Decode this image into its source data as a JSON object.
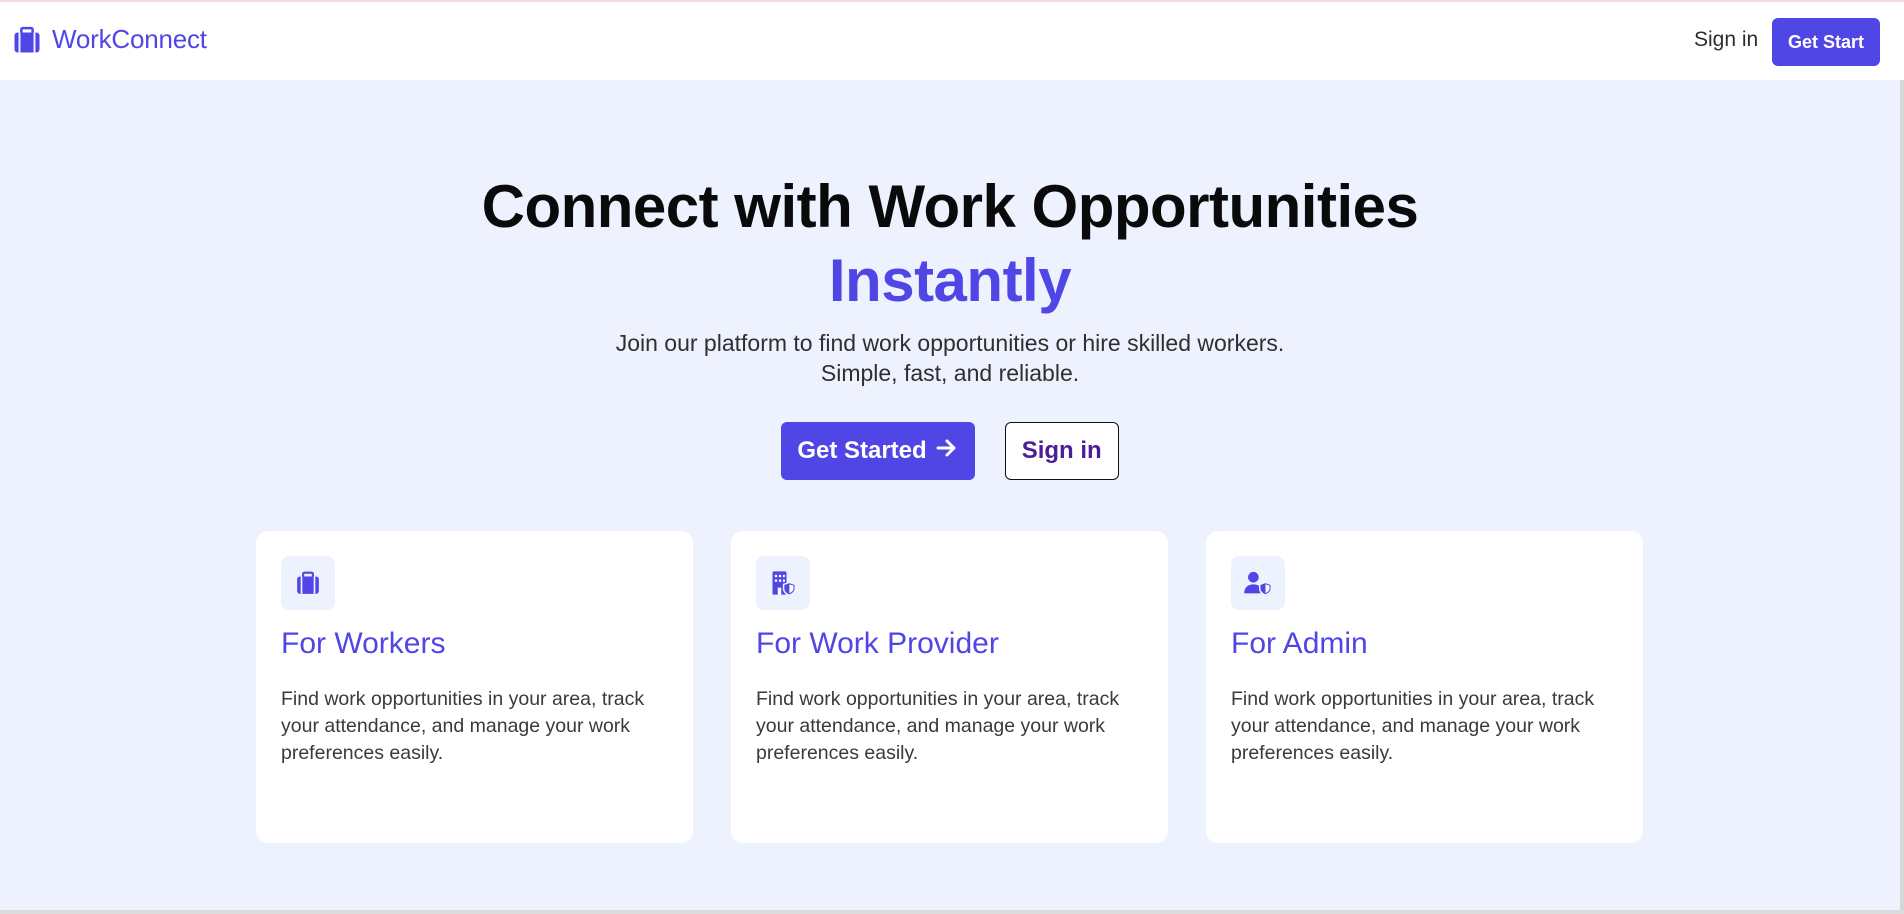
{
  "brand": {
    "name": "WorkConnect",
    "icon": "briefcase-icon"
  },
  "nav": {
    "signin_label": "Sign in",
    "getstart_label": "Get Start"
  },
  "hero": {
    "title_line1": "Connect with Work Opportunities",
    "title_line2": "Instantly",
    "subtitle_line1": "Join our platform to find work opportunities or hire skilled workers.",
    "subtitle_line2": "Simple, fast, and reliable.",
    "primary_label": "Get Started",
    "secondary_label": "Sign in"
  },
  "cards": [
    {
      "icon": "briefcase-icon",
      "title": "For Workers",
      "text": "Find work opportunities in your area, track your attendance, and manage your work preferences easily."
    },
    {
      "icon": "building-shield-icon",
      "title": "For Work Provider",
      "text": "Find work opportunities in your area, track your attendance, and manage your work preferences easily."
    },
    {
      "icon": "user-shield-icon",
      "title": "For Admin",
      "text": "Find work opportunities in your area, track your attendance, and manage your work preferences easily."
    }
  ],
  "colors": {
    "accent": "#4f46e5",
    "page_background": "#eef2fe",
    "card_background": "#ffffff",
    "secondary_button_text": "#4c1d95"
  }
}
